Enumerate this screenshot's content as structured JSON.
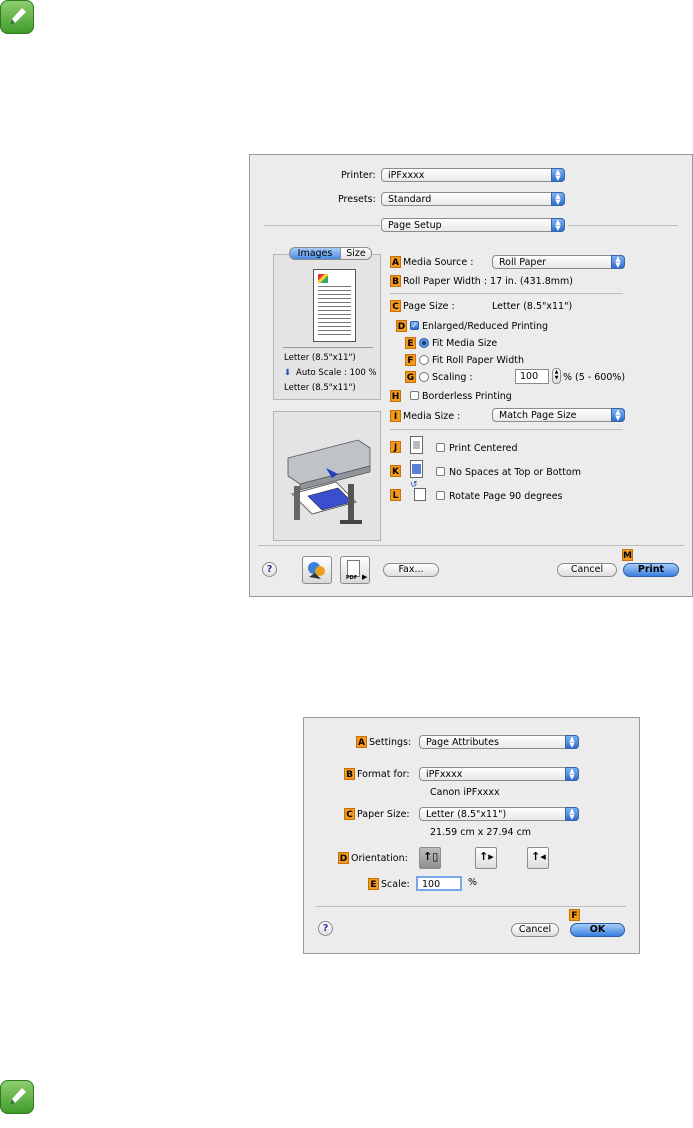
{
  "print_dialog": {
    "printer": {
      "label": "Printer:",
      "value": "iPFxxxx"
    },
    "presets": {
      "label": "Presets:",
      "value": "Standard"
    },
    "panel": {
      "value": "Page Setup"
    },
    "tabs": [
      "Images",
      "Size"
    ],
    "preview_info": [
      "Letter (8.5\"x11\")",
      "Auto Scale : 100 %",
      "Letter (8.5\"x11\")"
    ],
    "media_source": {
      "badge": "A",
      "label": "Media Source :",
      "value": "Roll Paper"
    },
    "roll_paper_width": {
      "badge": "B",
      "label": "Roll Paper Width : 17 in. (431.8mm)"
    },
    "page_size": {
      "badge": "C",
      "label": "Page Size :",
      "value": "Letter (8.5\"x11\")"
    },
    "enlarged": {
      "badge": "D",
      "label": "Enlarged/Reduced Printing",
      "checked": true
    },
    "fit_media": {
      "badge": "E",
      "label": "Fit Media Size",
      "selected": true
    },
    "fit_roll": {
      "badge": "F",
      "label": "Fit Roll Paper Width",
      "selected": false
    },
    "scaling": {
      "badge": "G",
      "label": "Scaling :",
      "value": "100",
      "suffix": "% (5 - 600%)"
    },
    "borderless": {
      "badge": "H",
      "label": "Borderless Printing",
      "checked": false
    },
    "media_size": {
      "badge": "I",
      "label": "Media Size :",
      "value": "Match Page Size"
    },
    "print_centered": {
      "badge": "J",
      "label": "Print Centered"
    },
    "no_spaces": {
      "badge": "K",
      "label": "No Spaces at Top or Bottom"
    },
    "rotate": {
      "badge": "L",
      "label": "Rotate Page 90 degrees"
    },
    "buttons": {
      "fax": "Fax...",
      "cancel": "Cancel",
      "print": "Print",
      "print_badge": "M",
      "pdf": "PDF",
      "help": "?"
    }
  },
  "page_setup_dialog": {
    "settings": {
      "badge": "A",
      "label": "Settings:",
      "value": "Page Attributes"
    },
    "format_for": {
      "badge": "B",
      "label": "Format for:",
      "value": "iPFxxxx",
      "sub": "Canon iPFxxxx"
    },
    "paper_size": {
      "badge": "C",
      "label": "Paper Size:",
      "value": "Letter (8.5\"x11\")",
      "sub": "21.59 cm x 27.94 cm"
    },
    "orientation": {
      "badge": "D",
      "label": "Orientation:"
    },
    "scale": {
      "badge": "E",
      "label": "Scale:",
      "value": "100",
      "unit": "%"
    },
    "buttons": {
      "cancel": "Cancel",
      "ok": "OK",
      "ok_badge": "F",
      "help": "?"
    }
  }
}
